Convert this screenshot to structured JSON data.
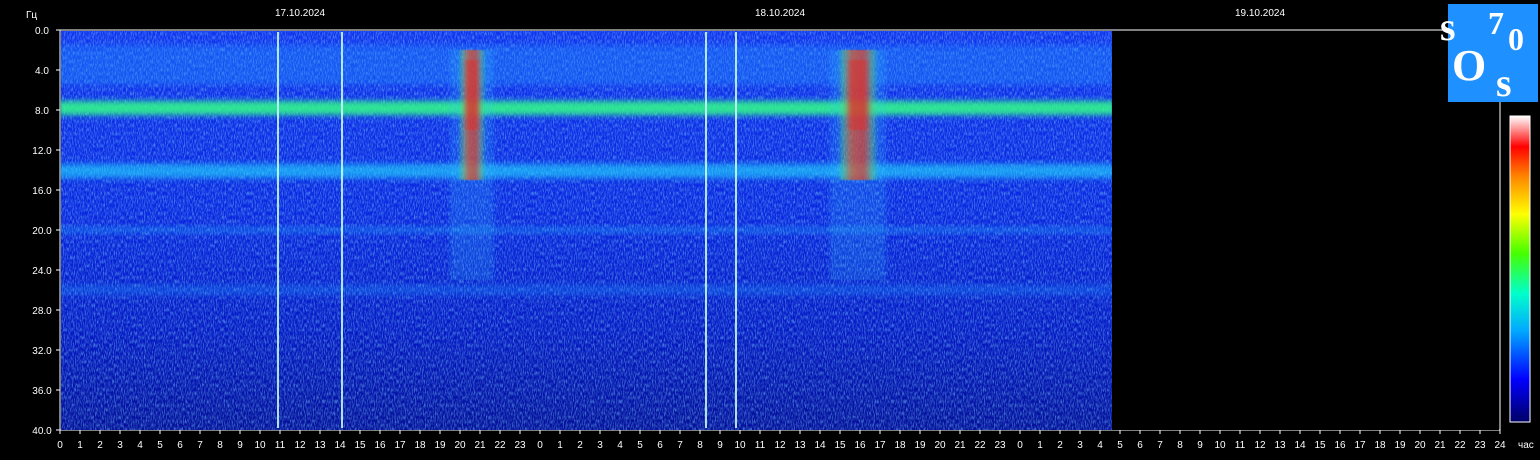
{
  "chart_data": {
    "type": "heatmap",
    "title": "",
    "ylabel": "Гц",
    "xlabel": "час",
    "ylim": [
      0,
      40
    ],
    "yticks": [
      "0.0",
      "4.0",
      "8.0",
      "12.0",
      "16.0",
      "20.0",
      "24.0",
      "28.0",
      "32.0",
      "36.0",
      "40.0"
    ],
    "dates": [
      "17.10.2024",
      "18.10.2024",
      "19.10.2024"
    ],
    "hour_ticks": [
      "0",
      "1",
      "2",
      "3",
      "4",
      "5",
      "6",
      "7",
      "8",
      "9",
      "10",
      "11",
      "12",
      "13",
      "14",
      "15",
      "16",
      "17",
      "18",
      "19",
      "20",
      "21",
      "22",
      "23",
      "0",
      "1",
      "2",
      "3",
      "4",
      "5",
      "6",
      "7",
      "8",
      "9",
      "10",
      "11",
      "12",
      "13",
      "14",
      "15",
      "16",
      "17",
      "18",
      "19",
      "20",
      "21",
      "22",
      "23",
      "0",
      "1",
      "2",
      "3",
      "4",
      "5",
      "6",
      "7",
      "8",
      "9",
      "10",
      "11",
      "12",
      "13",
      "14",
      "15",
      "16",
      "17",
      "18",
      "19",
      "20",
      "21",
      "22",
      "23",
      "24"
    ],
    "data_end_hour": 52.6,
    "resonance_bands_hz": [
      7.8,
      14.1,
      20.0,
      26.0
    ],
    "bursts": [
      {
        "start_hour": 20.0,
        "end_hour": 21.2
      },
      {
        "start_hour": 39.0,
        "end_hour": 40.8
      }
    ],
    "spikes_hour": [
      10.9,
      14.1,
      32.3,
      33.8
    ],
    "colorbar": [
      "#000066",
      "#0000ff",
      "#00ccff",
      "#00ff66",
      "#ffff00",
      "#ff8800",
      "#ff0000",
      "#ffffff"
    ]
  },
  "logo": {
    "l1": "s",
    "l2": "7",
    "l3": "0",
    "l4": "O",
    "l5": "s",
    "color": "#1e90ff"
  }
}
